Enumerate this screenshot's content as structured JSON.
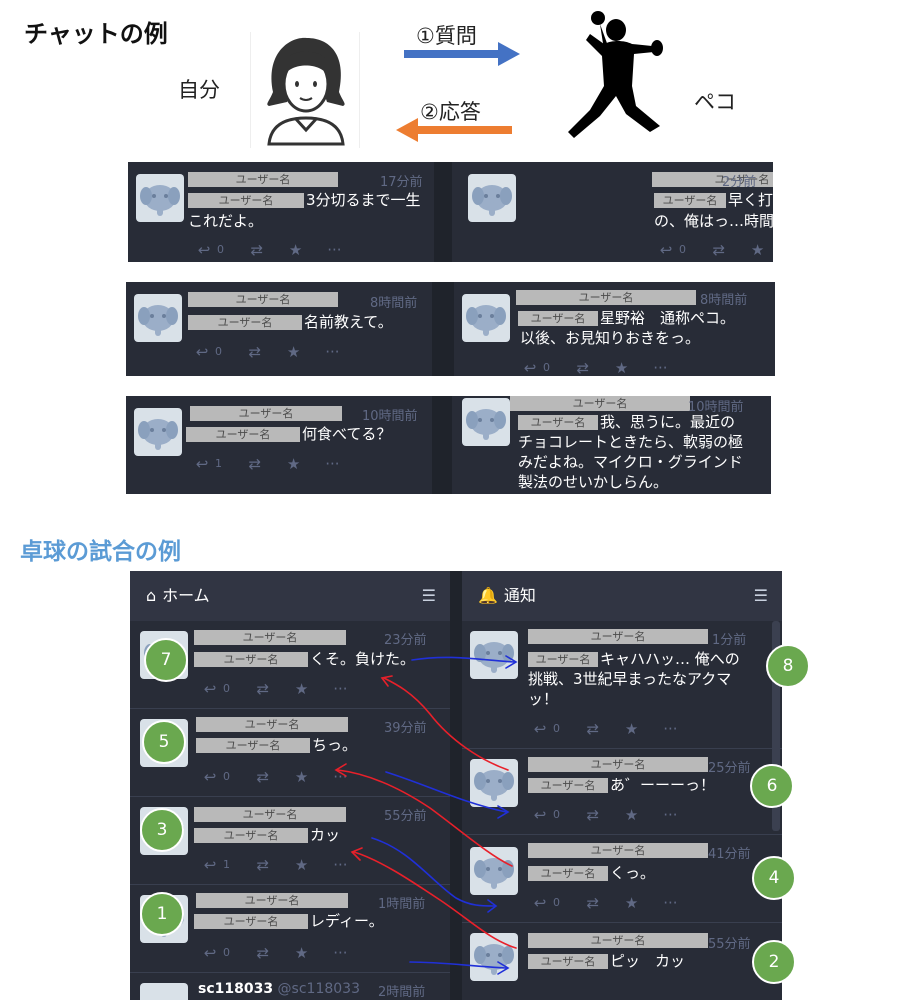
{
  "chat_section": {
    "title": "チャットの例",
    "self_label": "自分",
    "peko_label": "ペコ",
    "question_label": "①質問",
    "answer_label": "②応答",
    "arrow_colors": {
      "question": "#4472c4",
      "answer": "#ed7d31"
    }
  },
  "chat_rows": [
    {
      "left": {
        "name": "ユーザー名",
        "time": "17分前",
        "text_line1": "3分切るまで一生",
        "text_line2": "これだよ。",
        "reply_count": "0"
      },
      "right": {
        "name": "ユーザー名",
        "time": "2分前",
        "text_line1": "早く打球勘戻してえ",
        "text_line2": "の、俺はっ…時間ねえのよっ!!",
        "reply_count": "0"
      }
    },
    {
      "left": {
        "name": "ユーザー名",
        "time": "8時間前",
        "text_line1": "名前教えて。",
        "reply_count": "0"
      },
      "right": {
        "name": "ユーザー名",
        "time": "8時間前",
        "text_line1": "星野裕　通称ペコ。",
        "text_line2": "以後、お見知りおきをっ。",
        "reply_count": "0"
      }
    },
    {
      "left": {
        "name": "ユーザー名",
        "time": "10時間前",
        "text_line1": "何食べてる？",
        "reply_count": "1"
      },
      "right": {
        "name": "ユーザー名",
        "time": "10時間前",
        "text_line1": "我、思うに。最近の",
        "text_line2": "チョコレートときたら、軟弱の極",
        "text_line3": "みだよね。マイクロ・グラインド",
        "text_line4": "製法のせいかしらん。"
      }
    }
  ],
  "match_section": {
    "title": "卓球の試合の例",
    "home_header": "ホーム",
    "notif_header": "通知",
    "home_toots": [
      {
        "num": "7",
        "name": "ユーザー名",
        "time": "23分前",
        "text": "くそ。負けた。",
        "reply_count": "0"
      },
      {
        "num": "5",
        "name": "ユーザー名",
        "time": "39分前",
        "text": "ちっ。",
        "reply_count": "0"
      },
      {
        "num": "3",
        "name": "ユーザー名",
        "time": "55分前",
        "text": "カッ",
        "reply_count": "1"
      },
      {
        "num": "1",
        "name": "ユーザー名",
        "time": "1時間前",
        "text": "レディー。",
        "reply_count": "0"
      }
    ],
    "home_next": {
      "username": "sc118033",
      "handle": "@sc118033",
      "time": "2時間前"
    },
    "notif_toots": [
      {
        "num": "8",
        "name": "ユーザー名",
        "time": "1分前",
        "text_line1": "キャハハッ…  俺への",
        "text_line2": "挑戦、3世紀早まったなアクマ",
        "text_line3": "ッ！",
        "reply_count": "0"
      },
      {
        "num": "6",
        "name": "ユーザー名",
        "time": "25分前",
        "text_line1": "あ゛ーーーっ！",
        "reply_count": "0"
      },
      {
        "num": "4",
        "name": "ユーザー名",
        "time": "41分前",
        "text_line1": "くっ。",
        "reply_count": "0"
      },
      {
        "num": "2",
        "name": "ユーザー名",
        "time": "55分前",
        "text_line1": "ピッ　カッ"
      }
    ],
    "colors": {
      "circle": "#6aa84f",
      "red_arrow": "#e8202a",
      "blue_arrow": "#2030d8"
    }
  }
}
